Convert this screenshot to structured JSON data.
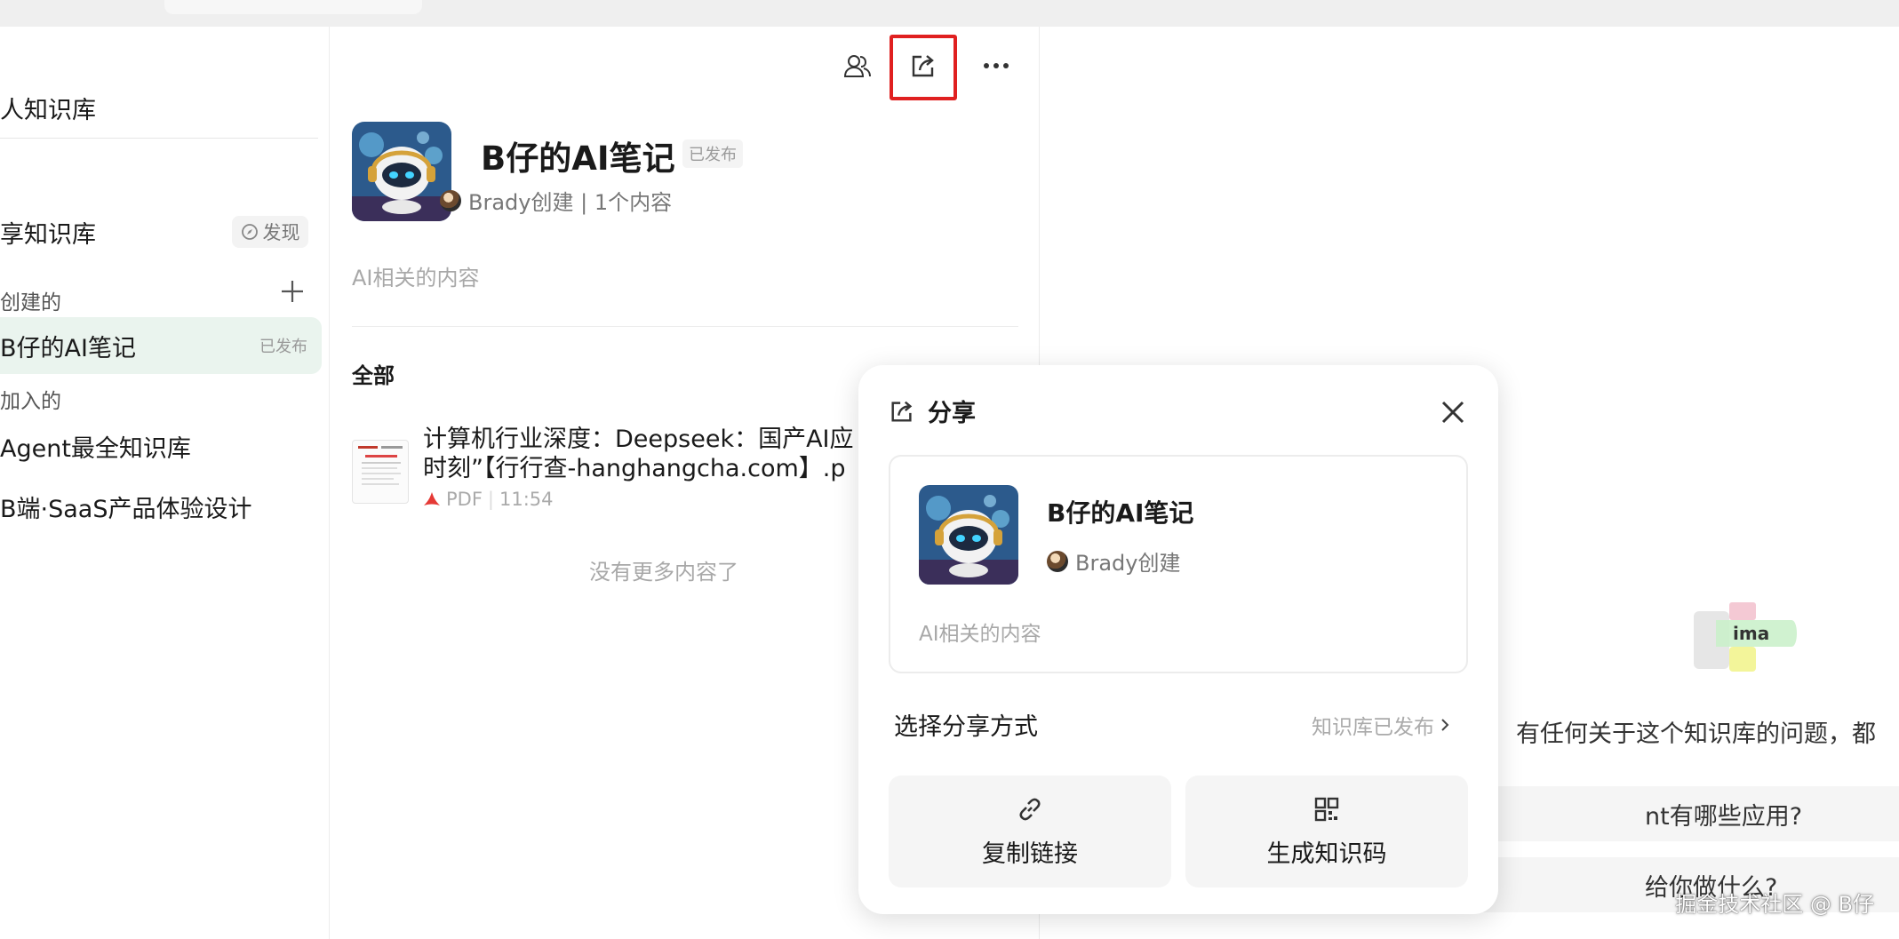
{
  "sidebar": {
    "personal_kb": "人知识库",
    "shared_kb": "享知识库",
    "discover_label": "发现",
    "created_group": "创建的",
    "joined_group": "加入的",
    "items": [
      {
        "label": "B仔的AI笔记",
        "badge": "已发布"
      },
      {
        "label": "Agent最全知识库"
      },
      {
        "label": "B端·SaaS产品体验设计"
      }
    ]
  },
  "knowledge_base": {
    "title": "B仔的AI笔记",
    "status": "已发布",
    "meta": "Brady创建 | 1个内容",
    "description": "AI相关的内容",
    "filter_label": "全部",
    "files": [
      {
        "title_line1": "计算机行业深度：Deepseek：国产AI应",
        "title_line2": "时刻”【行行查-hanghangcha.com】.p",
        "type": "PDF",
        "time": "11:54"
      }
    ],
    "no_more": "没有更多内容了"
  },
  "assistant": {
    "logo_text": "ima",
    "prompt_text": "有任何关于这个知识库的问题，都",
    "suggestions": [
      "nt有哪些应用?",
      "给你做什么?"
    ]
  },
  "share_dialog": {
    "title": "分享",
    "kb_name": "B仔的AI笔记",
    "kb_owner": "Brady创建",
    "kb_description": "AI相关的内容",
    "method_label": "选择分享方式",
    "method_status": "知识库已发布",
    "copy_link": "复制链接",
    "gen_code": "生成知识码"
  },
  "watermark": "掘金技术社区 @ B仔",
  "colors": {
    "accent_red": "#e02020",
    "active_bg": "#eaf4ee"
  }
}
